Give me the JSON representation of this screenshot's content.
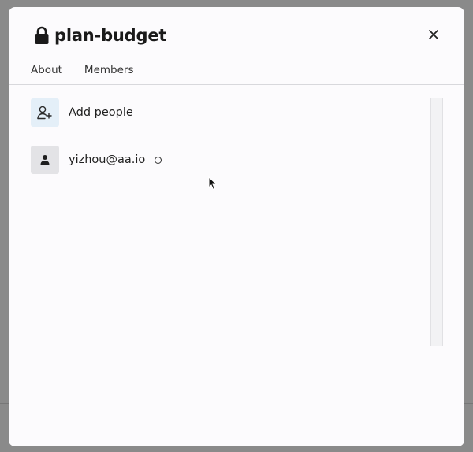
{
  "dialog": {
    "title": "plan-budget",
    "lock_icon": "lock-icon",
    "close_icon": "close-icon"
  },
  "tabs": [
    {
      "label": "About"
    },
    {
      "label": "Members"
    }
  ],
  "members": {
    "add_label": "Add people",
    "add_icon": "add-person-icon",
    "items": [
      {
        "email": "yizhou@aa.io",
        "icon": "person-icon",
        "status": "offline"
      }
    ]
  }
}
